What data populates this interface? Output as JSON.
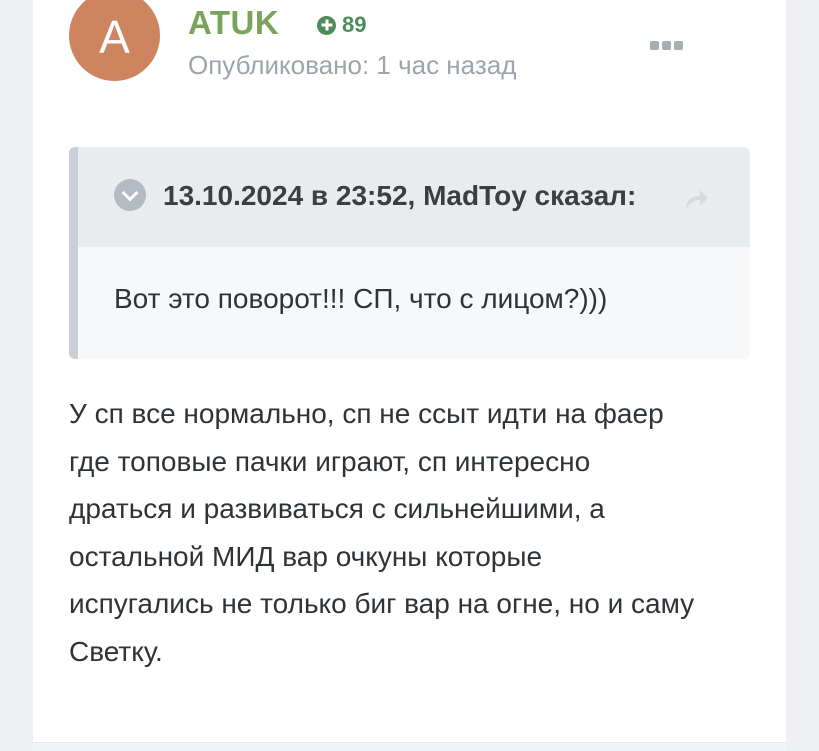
{
  "post": {
    "avatar_letter": "A",
    "author": "ATUK",
    "reputation": "89",
    "posted_time": "Опубликовано: 1 час назад",
    "more_icon": "ellipsis-icon"
  },
  "quote": {
    "citation": "13.10.2024 в 23:52, MadToy сказал:",
    "text": "Вот это поворот!!! СП, что с лицом?)))",
    "toggle_icon": "chevron-down-icon",
    "share_icon": "share-arrow-icon"
  },
  "content": {
    "lines": [
      "У сп все нормально, сп не ссыт идти на фаер",
      "где топовые пачки играют, сп интересно",
      "драться и развиваться с сильнейшими, а",
      "остальной МИД вар очкуны которые",
      "испугались не только биг вар на огне, но и саму",
      "Светку."
    ]
  },
  "colors": {
    "avatar": "#cf8460",
    "author": "#7aa35a",
    "reputation": "#4f8a5b",
    "meta": "#9ea4ab",
    "text": "#2f3337"
  }
}
